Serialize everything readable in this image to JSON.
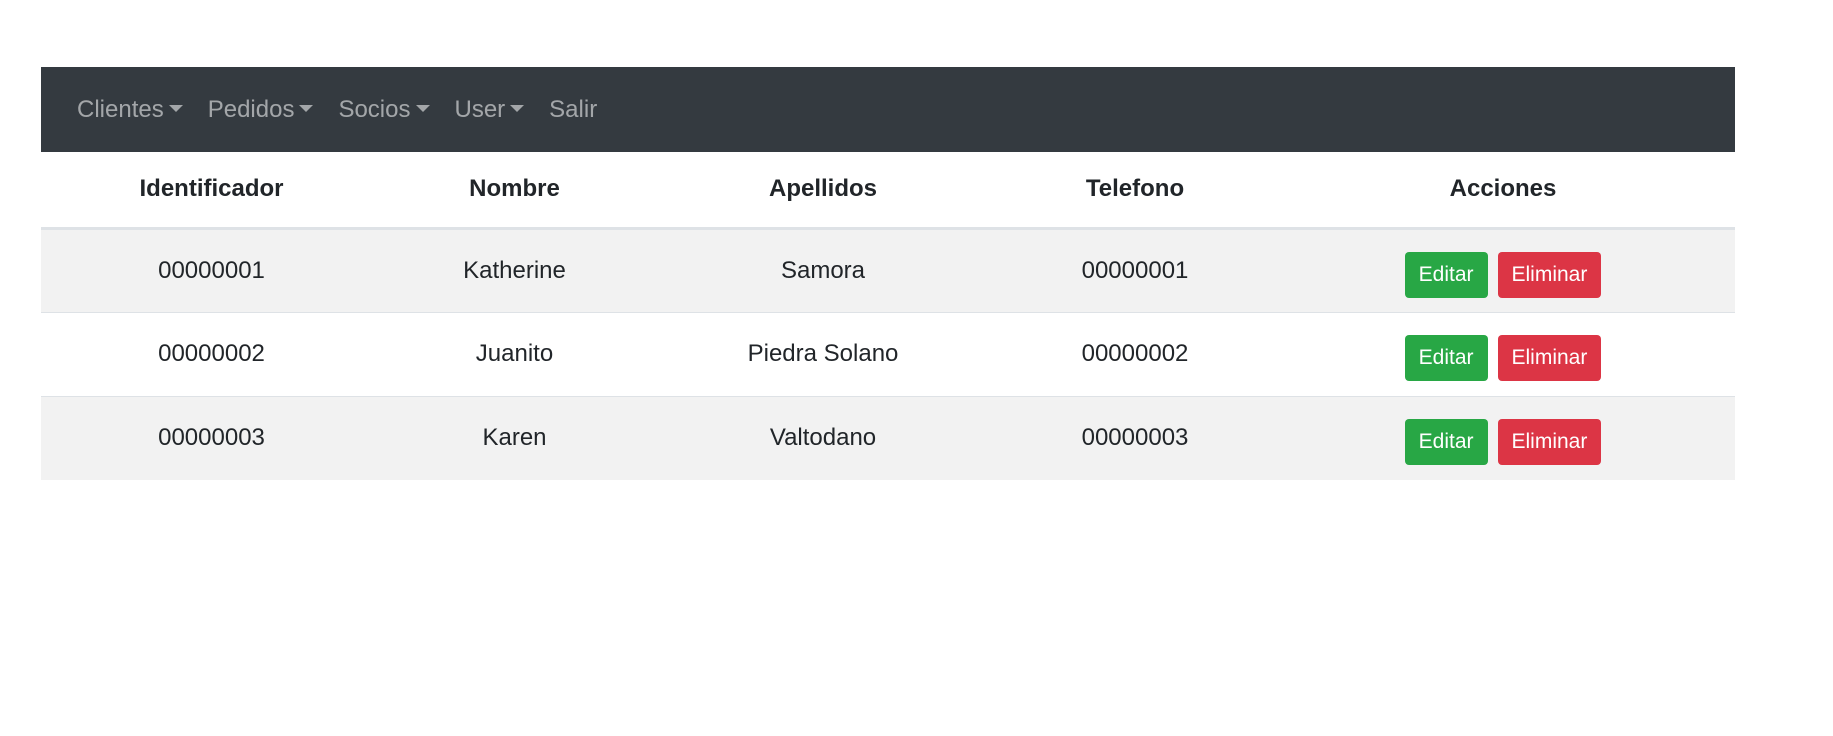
{
  "navbar": {
    "items": [
      {
        "label": "Clientes",
        "dropdown": true
      },
      {
        "label": "Pedidos",
        "dropdown": true
      },
      {
        "label": "Socios",
        "dropdown": true
      },
      {
        "label": "User",
        "dropdown": true
      },
      {
        "label": "Salir",
        "dropdown": false
      }
    ]
  },
  "table": {
    "headers": [
      "Identificador",
      "Nombre",
      "Apellidos",
      "Telefono",
      "Acciones"
    ],
    "rows": [
      {
        "id": "00000001",
        "nombre": "Katherine",
        "apellidos": "Samora",
        "telefono": "00000001"
      },
      {
        "id": "00000002",
        "nombre": "Juanito",
        "apellidos": "Piedra Solano",
        "telefono": "00000002"
      },
      {
        "id": "00000003",
        "nombre": "Karen",
        "apellidos": "Valtodano",
        "telefono": "00000003"
      }
    ],
    "actions": {
      "edit_label": "Editar",
      "delete_label": "Eliminar"
    }
  },
  "colors": {
    "navbar_bg": "#343a40",
    "edit_button": "#28a745",
    "delete_button": "#dc3545",
    "striped_row": "#f2f2f2"
  }
}
